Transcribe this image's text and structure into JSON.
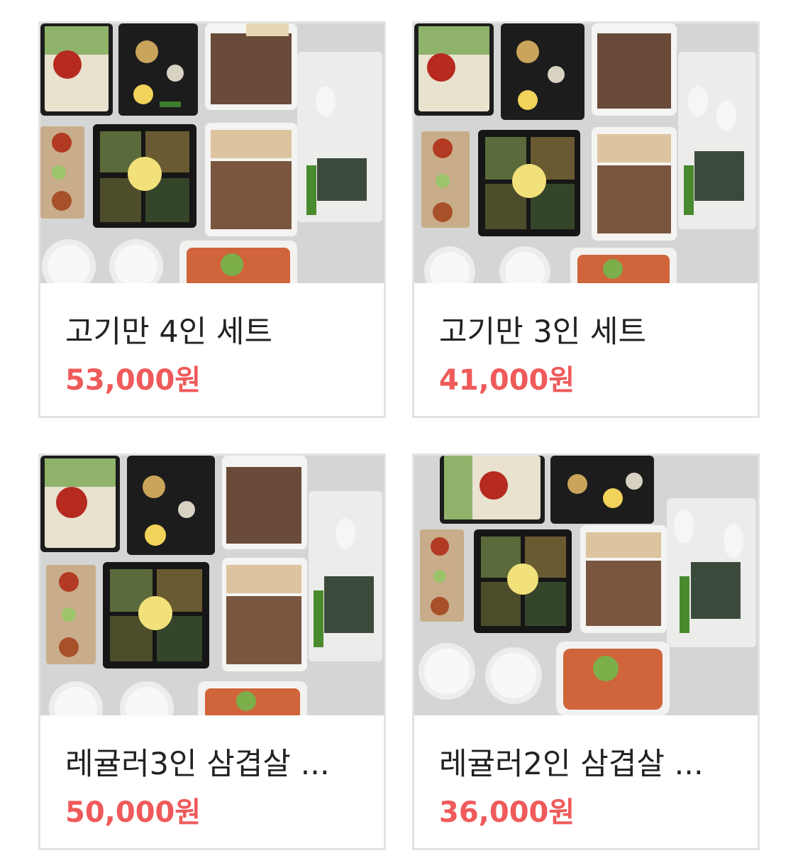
{
  "products": [
    {
      "name": "고기만 4인 세트",
      "price": "53,000원",
      "image_icon": "meal-kit-photo-icon"
    },
    {
      "name": "고기만 3인 세트",
      "price": "41,000원",
      "image_icon": "meal-kit-photo-icon"
    },
    {
      "name": "레귤러3인 삼겹살 ...",
      "price": "50,000원",
      "image_icon": "meal-kit-photo-icon"
    },
    {
      "name": "레귤러2인 삼겹살 ...",
      "price": "36,000원",
      "image_icon": "meal-kit-photo-icon"
    }
  ],
  "colors": {
    "price": "#ef5a5a",
    "name": "#222222",
    "card_border": "#e3e3e3",
    "photo_background": "#d2d3d3"
  }
}
